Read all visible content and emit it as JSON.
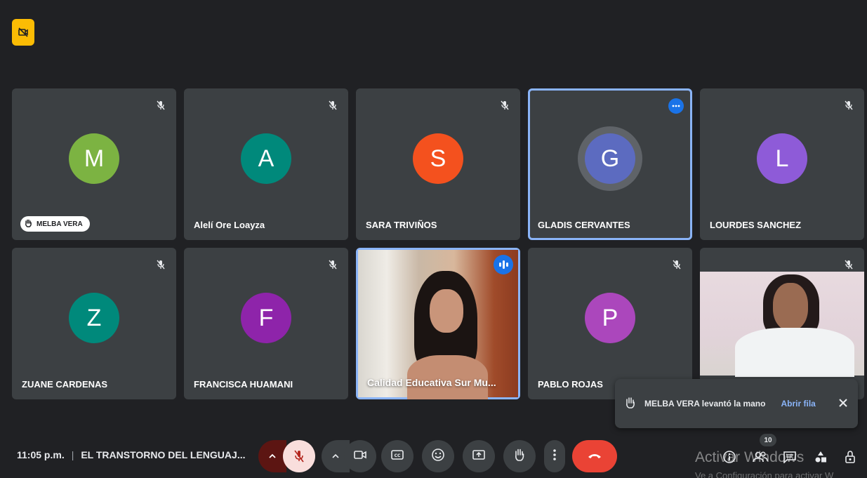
{
  "colors": {
    "background": "#202124",
    "tile": "#3c4043",
    "accent": "#8ab4f8",
    "badge": "#fbbc04",
    "end_call": "#ea4335"
  },
  "participants": [
    {
      "initial": "M",
      "name": "MELBA VERA",
      "color": "#7cb342",
      "hand_raised": true
    },
    {
      "initial": "A",
      "name": "Alelí Ore Loayza",
      "color": "#00897b"
    },
    {
      "initial": "S",
      "name": "SARA TRIVIÑOS",
      "color": "#f4511e"
    },
    {
      "initial": "G",
      "name": "GLADIS CERVANTES",
      "color": "#5c6bc0"
    },
    {
      "initial": "L",
      "name": "LOURDES SANCHEZ",
      "color": "#8e5bd8"
    },
    {
      "initial": "Z",
      "name": "ZUANE CARDENAS",
      "color": "#00897b"
    },
    {
      "initial": "F",
      "name": "FRANCISCA HUAMANI",
      "color": "#8e24aa"
    },
    {
      "name": "Calidad Educativa Sur Mu..."
    },
    {
      "initial": "P",
      "name": "PABLO ROJAS",
      "color": "#ab47bc"
    }
  ],
  "toast": {
    "message": "MELBA VERA levantó la mano",
    "action": "Abrir fila"
  },
  "bottom": {
    "time": "11:05 p.m.",
    "separator": "|",
    "meeting_title": "EL TRANSTORNO DEL LENGUAJ...",
    "participant_count": "10",
    "watermark_line1": "Activar Windows",
    "watermark_line2": "Ve a Configuración para activar W"
  },
  "icons": {
    "top_badge": "no-camera-icon",
    "mic_off": "mic-off-icon",
    "hand": "hand-raised-icon",
    "camera": "camera-icon",
    "captions": "captions-icon",
    "emoji": "emoji-icon",
    "present": "present-icon",
    "more": "more-vert-icon",
    "end_call": "end-call-icon",
    "info": "info-icon",
    "people": "people-icon",
    "chat": "chat-icon",
    "activities": "activities-icon",
    "lock": "host-controls-icon"
  }
}
